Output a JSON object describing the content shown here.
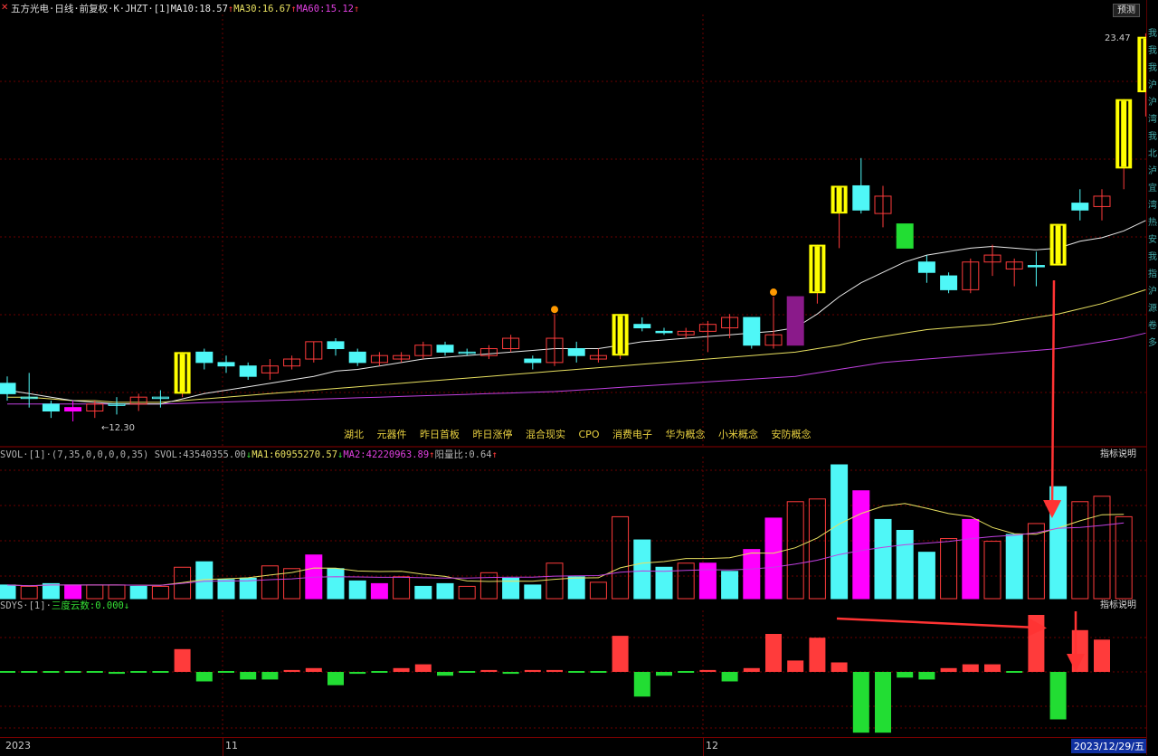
{
  "header": {
    "close_icon": "close-icon",
    "stock_name": "五方光电·日线·前复权·K·JHZT·[1]",
    "ma10": "MA10:18.57",
    "ma30": "MA30:16.67",
    "ma60": "MA60:15.12",
    "up_arrow": "↑",
    "predict_button": "预测"
  },
  "price_labels": {
    "high": "23.47",
    "low": "12.30"
  },
  "concepts": [
    "湖北",
    "元器件",
    "昨日首板",
    "昨日涨停",
    "混合现实",
    "CPO",
    "消费电子",
    "华为概念",
    "小米概念",
    "安防概念"
  ],
  "volume_title": {
    "name": "SVOL·[1]·(7,35,0,0,0,0,35)",
    "svol": "SVOL:43540355.00",
    "ma1": "MA1:60955270.57",
    "ma2": "MA2:42220963.89",
    "ratio": "阳量比:0.64",
    "down_arrow": "↓",
    "up_arrow": "↑",
    "help": "指标说明"
  },
  "sdys_title": {
    "name": "SDYS·[1]·",
    "value": "三度云数:0.000",
    "down_arrow": "↓",
    "help": "指标说明"
  },
  "date_axis": {
    "year": "2023",
    "nov": "11",
    "dec": "12",
    "current": "2023/12/29/五"
  },
  "right_strip": [
    "我",
    "我",
    "我",
    "沪",
    "沪",
    "湾",
    "我",
    "北",
    "泸",
    "宜",
    "湾",
    "热",
    "安",
    "我",
    "指",
    "沪",
    "源",
    "卷",
    "多"
  ],
  "colors": {
    "up_bar": "#ff3b3b",
    "down_bar": "#4ff7f7",
    "limit_up": "#ffff00",
    "magenta": "#ff00ff",
    "purple": "#8a1a8a",
    "ma10": "#e8e8e8",
    "ma30": "#e8e060",
    "ma60": "#c040e0",
    "green_bar": "#22dd33"
  },
  "chart_data": {
    "type": "candlestick",
    "ylim": [
      12.3,
      23.47
    ],
    "candles": [
      {
        "o": 13.4,
        "c": 13.1,
        "h": 13.6,
        "l": 12.9,
        "t": "down"
      },
      {
        "o": 13.0,
        "c": 13.0,
        "h": 13.7,
        "l": 12.7,
        "t": "flat"
      },
      {
        "o": 12.8,
        "c": 12.6,
        "h": 12.9,
        "l": 12.4,
        "t": "down"
      },
      {
        "o": 12.7,
        "c": 12.6,
        "h": 12.9,
        "l": 12.3,
        "t": "mag"
      },
      {
        "o": 12.6,
        "c": 12.8,
        "h": 12.9,
        "l": 12.4,
        "t": "up"
      },
      {
        "o": 12.8,
        "c": 12.8,
        "h": 13.0,
        "l": 12.5,
        "t": "flat"
      },
      {
        "o": 12.8,
        "c": 13.0,
        "h": 13.1,
        "l": 12.6,
        "t": "up"
      },
      {
        "o": 13.0,
        "c": 13.0,
        "h": 13.2,
        "l": 12.7,
        "t": "flat"
      },
      {
        "o": 13.1,
        "c": 14.3,
        "h": 14.3,
        "l": 13.0,
        "t": "limit"
      },
      {
        "o": 14.3,
        "c": 14.0,
        "h": 14.4,
        "l": 13.8,
        "t": "down"
      },
      {
        "o": 14.0,
        "c": 13.9,
        "h": 14.2,
        "l": 13.7,
        "t": "down"
      },
      {
        "o": 13.9,
        "c": 13.6,
        "h": 14.0,
        "l": 13.5,
        "t": "down"
      },
      {
        "o": 13.7,
        "c": 13.9,
        "h": 14.1,
        "l": 13.5,
        "t": "up"
      },
      {
        "o": 13.9,
        "c": 14.1,
        "h": 14.2,
        "l": 13.8,
        "t": "up"
      },
      {
        "o": 14.1,
        "c": 14.6,
        "h": 14.6,
        "l": 14.0,
        "t": "up"
      },
      {
        "o": 14.6,
        "c": 14.4,
        "h": 14.7,
        "l": 14.2,
        "t": "down"
      },
      {
        "o": 14.3,
        "c": 14.0,
        "h": 14.4,
        "l": 13.9,
        "t": "down"
      },
      {
        "o": 14.0,
        "c": 14.2,
        "h": 14.3,
        "l": 13.9,
        "t": "up"
      },
      {
        "o": 14.1,
        "c": 14.2,
        "h": 14.3,
        "l": 14.0,
        "t": "up"
      },
      {
        "o": 14.2,
        "c": 14.5,
        "h": 14.6,
        "l": 14.1,
        "t": "up"
      },
      {
        "o": 14.5,
        "c": 14.3,
        "h": 14.6,
        "l": 14.2,
        "t": "down"
      },
      {
        "o": 14.3,
        "c": 14.3,
        "h": 14.4,
        "l": 14.2,
        "t": "flat"
      },
      {
        "o": 14.2,
        "c": 14.4,
        "h": 14.5,
        "l": 14.1,
        "t": "up"
      },
      {
        "o": 14.4,
        "c": 14.7,
        "h": 14.8,
        "l": 14.3,
        "t": "up"
      },
      {
        "o": 14.1,
        "c": 14.0,
        "h": 14.2,
        "l": 13.8,
        "t": "down"
      },
      {
        "o": 14.0,
        "c": 14.7,
        "h": 15.4,
        "l": 13.9,
        "t": "up"
      },
      {
        "o": 14.4,
        "c": 14.2,
        "h": 14.6,
        "l": 14.0,
        "t": "down"
      },
      {
        "o": 14.1,
        "c": 14.2,
        "h": 14.4,
        "l": 14.0,
        "t": "up"
      },
      {
        "o": 14.2,
        "c": 15.4,
        "h": 15.4,
        "l": 14.1,
        "t": "limit"
      },
      {
        "o": 15.1,
        "c": 15.0,
        "h": 15.3,
        "l": 14.9,
        "t": "down"
      },
      {
        "o": 14.9,
        "c": 14.9,
        "h": 15.0,
        "l": 14.8,
        "t": "down"
      },
      {
        "o": 14.8,
        "c": 14.9,
        "h": 15.0,
        "l": 14.7,
        "t": "up"
      },
      {
        "o": 14.9,
        "c": 15.1,
        "h": 15.2,
        "l": 14.3,
        "t": "up"
      },
      {
        "o": 15.0,
        "c": 15.3,
        "h": 15.4,
        "l": 14.7,
        "t": "up"
      },
      {
        "o": 15.3,
        "c": 14.5,
        "h": 15.3,
        "l": 14.4,
        "t": "down"
      },
      {
        "o": 14.5,
        "c": 14.8,
        "h": 15.9,
        "l": 14.4,
        "t": "up"
      },
      {
        "o": 14.5,
        "c": 15.9,
        "h": 15.9,
        "l": 14.5,
        "t": "purple"
      },
      {
        "o": 16.0,
        "c": 17.4,
        "h": 17.4,
        "l": 15.7,
        "t": "limit"
      },
      {
        "o": 18.3,
        "c": 19.1,
        "h": 19.1,
        "l": 17.3,
        "t": "limit"
      },
      {
        "o": 19.1,
        "c": 18.4,
        "h": 19.9,
        "l": 18.3,
        "t": "down"
      },
      {
        "o": 18.3,
        "c": 18.8,
        "h": 19.1,
        "l": 17.9,
        "t": "up"
      },
      {
        "o": 18.0,
        "c": 17.3,
        "h": 18.0,
        "l": 17.3,
        "t": "green"
      },
      {
        "o": 16.9,
        "c": 16.6,
        "h": 17.1,
        "l": 16.3,
        "t": "down"
      },
      {
        "o": 16.5,
        "c": 16.1,
        "h": 16.6,
        "l": 16.0,
        "t": "down"
      },
      {
        "o": 16.1,
        "c": 16.9,
        "h": 17.0,
        "l": 16.0,
        "t": "up"
      },
      {
        "o": 16.9,
        "c": 17.1,
        "h": 17.4,
        "l": 16.5,
        "t": "up"
      },
      {
        "o": 16.7,
        "c": 16.9,
        "h": 17.0,
        "l": 16.2,
        "t": "up"
      },
      {
        "o": 16.8,
        "c": 16.8,
        "h": 17.2,
        "l": 16.2,
        "t": "down"
      },
      {
        "o": 16.8,
        "c": 18.0,
        "h": 18.0,
        "l": 16.8,
        "t": "limit"
      },
      {
        "o": 18.6,
        "c": 18.4,
        "h": 19.0,
        "l": 18.1,
        "t": "down"
      },
      {
        "o": 18.5,
        "c": 18.8,
        "h": 19.0,
        "l": 18.1,
        "t": "up"
      },
      {
        "o": 19.6,
        "c": 21.6,
        "h": 21.6,
        "l": 19.0,
        "t": "limit"
      },
      {
        "o": 21.8,
        "c": 23.4,
        "h": 23.5,
        "l": 21.1,
        "t": "limit"
      }
    ],
    "ma10": [
      13.2,
      13.1,
      13.0,
      12.9,
      12.85,
      12.8,
      12.8,
      12.8,
      12.95,
      13.1,
      13.2,
      13.3,
      13.4,
      13.5,
      13.6,
      13.75,
      13.8,
      13.9,
      14.0,
      14.1,
      14.15,
      14.2,
      14.25,
      14.3,
      14.35,
      14.4,
      14.4,
      14.4,
      14.5,
      14.6,
      14.65,
      14.7,
      14.75,
      14.8,
      14.85,
      14.9,
      15.0,
      15.4,
      15.9,
      16.3,
      16.6,
      16.9,
      17.1,
      17.2,
      17.3,
      17.35,
      17.3,
      17.25,
      17.3,
      17.5,
      17.6,
      17.8,
      18.1
    ],
    "ma30": [
      13.0,
      13.0,
      12.95,
      12.9,
      12.9,
      12.85,
      12.85,
      12.85,
      12.9,
      12.95,
      13.0,
      13.05,
      13.1,
      13.15,
      13.2,
      13.25,
      13.3,
      13.35,
      13.4,
      13.45,
      13.5,
      13.55,
      13.6,
      13.65,
      13.7,
      13.75,
      13.8,
      13.85,
      13.9,
      13.95,
      14.0,
      14.05,
      14.1,
      14.15,
      14.2,
      14.25,
      14.3,
      14.4,
      14.5,
      14.65,
      14.75,
      14.85,
      14.95,
      15.0,
      15.05,
      15.1,
      15.2,
      15.3,
      15.4,
      15.55,
      15.7,
      15.9,
      16.1
    ],
    "ma60": [
      12.8,
      12.8,
      12.8,
      12.8,
      12.8,
      12.8,
      12.8,
      12.8,
      12.82,
      12.84,
      12.86,
      12.88,
      12.9,
      12.92,
      12.94,
      12.96,
      12.98,
      13.0,
      13.02,
      13.04,
      13.06,
      13.08,
      13.1,
      13.12,
      13.14,
      13.16,
      13.2,
      13.24,
      13.28,
      13.32,
      13.36,
      13.4,
      13.44,
      13.48,
      13.52,
      13.56,
      13.6,
      13.7,
      13.8,
      13.9,
      14.0,
      14.05,
      14.1,
      14.15,
      14.2,
      14.25,
      14.3,
      14.35,
      14.4,
      14.5,
      14.6,
      14.7,
      14.85
    ],
    "volume": [
      {
        "v": 10,
        "t": "cyan"
      },
      {
        "v": 9,
        "t": "up"
      },
      {
        "v": 11,
        "t": "cyan"
      },
      {
        "v": 10,
        "t": "mag"
      },
      {
        "v": 10,
        "t": "up"
      },
      {
        "v": 10,
        "t": "up"
      },
      {
        "v": 9,
        "t": "cyan"
      },
      {
        "v": 9,
        "t": "up"
      },
      {
        "v": 23,
        "t": "up"
      },
      {
        "v": 27,
        "t": "cyan"
      },
      {
        "v": 14,
        "t": "cyan"
      },
      {
        "v": 15,
        "t": "cyan"
      },
      {
        "v": 24,
        "t": "up"
      },
      {
        "v": 22,
        "t": "up"
      },
      {
        "v": 32,
        "t": "mag"
      },
      {
        "v": 22,
        "t": "cyan"
      },
      {
        "v": 13,
        "t": "cyan"
      },
      {
        "v": 11,
        "t": "mag"
      },
      {
        "v": 16,
        "t": "up"
      },
      {
        "v": 9,
        "t": "cyan"
      },
      {
        "v": 11,
        "t": "cyan"
      },
      {
        "v": 9,
        "t": "up"
      },
      {
        "v": 19,
        "t": "up"
      },
      {
        "v": 15,
        "t": "cyan"
      },
      {
        "v": 10,
        "t": "cyan"
      },
      {
        "v": 26,
        "t": "up"
      },
      {
        "v": 16,
        "t": "cyan"
      },
      {
        "v": 12,
        "t": "up"
      },
      {
        "v": 60,
        "t": "up"
      },
      {
        "v": 43,
        "t": "cyan"
      },
      {
        "v": 23,
        "t": "cyan"
      },
      {
        "v": 26,
        "t": "up"
      },
      {
        "v": 26,
        "t": "mag"
      },
      {
        "v": 20,
        "t": "cyan"
      },
      {
        "v": 36,
        "t": "mag"
      },
      {
        "v": 59,
        "t": "mag"
      },
      {
        "v": 71,
        "t": "up"
      },
      {
        "v": 73,
        "t": "up"
      },
      {
        "v": 98,
        "t": "cyan"
      },
      {
        "v": 79,
        "t": "mag"
      },
      {
        "v": 58,
        "t": "cyan"
      },
      {
        "v": 50,
        "t": "cyan"
      },
      {
        "v": 34,
        "t": "cyan"
      },
      {
        "v": 44,
        "t": "up"
      },
      {
        "v": 58,
        "t": "mag"
      },
      {
        "v": 42,
        "t": "up"
      },
      {
        "v": 47,
        "t": "cyan"
      },
      {
        "v": 55,
        "t": "up"
      },
      {
        "v": 82,
        "t": "cyan"
      },
      {
        "v": 71,
        "t": "up"
      },
      {
        "v": 75,
        "t": "up"
      },
      {
        "v": 60,
        "t": "up"
      }
    ],
    "sdys": [
      0,
      0,
      0,
      0,
      0,
      -1,
      0,
      0,
      12,
      -5,
      0,
      -4,
      -4,
      1,
      2,
      -7,
      -1,
      0,
      2,
      4,
      -2,
      0,
      1,
      -1,
      1,
      1,
      0,
      0,
      19,
      -13,
      -2,
      0,
      1,
      -5,
      2,
      20,
      6,
      18,
      5,
      -32,
      -32,
      -3,
      -4,
      2,
      4,
      4,
      0,
      30,
      -25,
      22,
      17
    ]
  }
}
